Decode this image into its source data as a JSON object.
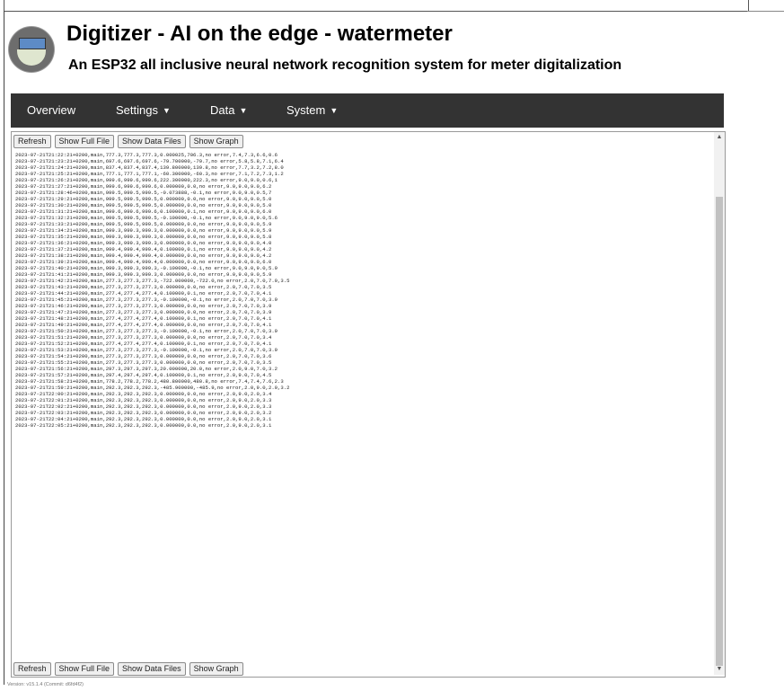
{
  "header": {
    "title": "Digitizer - AI on the edge - watermeter",
    "subtitle": "An ESP32 all inclusive neural network recognition system for meter digitalization"
  },
  "nav": [
    {
      "label": "Overview",
      "dropdown": false
    },
    {
      "label": "Settings",
      "dropdown": true
    },
    {
      "label": "Data",
      "dropdown": true
    },
    {
      "label": "System",
      "dropdown": true
    }
  ],
  "buttons": {
    "refresh": "Refresh",
    "show_full_file": "Show Full File",
    "show_data_files": "Show Data Files",
    "show_graph": "Show Graph"
  },
  "log_lines": [
    "2023-07-21T21:22:21+0200,main,777.3,777.3,777.3,0.000025,706.3,no error,7.4,7.3,6.6,0.6",
    "2023-07-21T21:23:21+0200,main,697.6,697.6,697.6,-79.700000,-79.7,no error,5.8,5.8,7.1,6.4",
    "2023-07-21T21:24:21+0200,main,837.4,837.4,837.4,139.800000,139.8,no error,7.7,3.2,7.2,8.0",
    "2023-07-21T21:25:21+0200,main,777.1,777.1,777.1,-60.300000,-60.3,no error,7.1,7.2,7.3,1.2",
    "2023-07-21T21:26:21+0200,main,999.6,999.6,999.6,222.300000,222.3,no error,9.0,9.0,0.6,1",
    "2023-07-21T21:27:21+0200,main,999.6,999.6,999.6,0.000000,0.0,no error,9.0,9.0,9.0,6.2",
    "2023-07-21T21:28:46+0200,main,999.5,999.5,999.5,-0.073888,-0.1,no error,9.0,9.0,0.5,7",
    "2023-07-21T21:29:21+0200,main,999.5,999.5,999.5,0.000000,0.0,no error,9.0,9.0,9.0,5.0",
    "2023-07-21T21:30:21+0200,main,999.5,999.5,999.5,0.000000,0.0,no error,9.0,9.0,9.0,5.0",
    "2023-07-21T21:31:21+0200,main,999.6,999.6,999.6,0.100000,0.1,no error,9.0,9.0,9.0,6.0",
    "2023-07-21T21:32:21+0200,main,999.5,999.5,999.5,-0.100000,-0.1,no error,9.0,9.0,9.0,5.6",
    "2023-07-21T21:33:21+0200,main,999.5,999.5,999.5,0.000000,0.0,no error,9.0,9.0,9.0,5.9",
    "2023-07-21T21:34:21+0200,main,999.3,999.3,999.3,0.000000,0.0,no error,9.0,9.0,9.0,5.9",
    "2023-07-21T21:35:21+0200,main,999.3,999.3,999.3,0.000000,0.0,no error,9.0,9.0,9.0,5.8",
    "2023-07-21T21:36:21+0200,main,999.3,999.3,999.3,0.000000,0.0,no error,9.0,9.0,9.0,4.0",
    "2023-07-21T21:37:21+0200,main,999.4,999.4,999.4,0.100000,0.1,no error,9.0,9.0,9.0,4.2",
    "2023-07-21T21:38:21+0200,main,999.4,999.4,999.4,0.000000,0.0,no error,9.0,9.0,9.0,4.2",
    "2023-07-21T21:39:21+0200,main,999.4,999.4,999.4,0.000000,0.0,no error,9.0,9.0,9.0,6.0",
    "2023-07-21T21:40:21+0200,main,999.3,999.3,999.3,-0.100000,-0.1,no error,9.0,9.0,9.0,5.9",
    "2023-07-21T21:41:21+0200,main,999.3,999.3,999.3,0.000000,0.0,no error,9.0,9.0,9.0,5.9",
    "2023-07-21T21:42:21+0200,main,277.3,277.3,277.3,-722.000000,-722.0,no error,2.0,7.0,7.0,3.5",
    "2023-07-21T21:43:21+0200,main,277.3,277.3,277.3,0.000000,0.0,no error,2.0,7.0,7.0,3.5",
    "2023-07-21T21:44:21+0200,main,277.4,277.4,277.4,0.100000,0.1,no error,2.0,7.0,7.0,4.1",
    "2023-07-21T21:45:21+0200,main,277.3,277.3,277.3,-0.100000,-0.1,no error,2.0,7.0,7.0,3.9",
    "2023-07-21T21:46:21+0200,main,277.3,277.3,277.3,0.000000,0.0,no error,2.0,7.0,7.0,3.9",
    "2023-07-21T21:47:21+0200,main,277.3,277.3,277.3,0.000000,0.0,no error,2.0,7.0,7.0,3.9",
    "2023-07-21T21:48:21+0200,main,277.4,277.4,277.4,0.100000,0.1,no error,2.0,7.0,7.0,4.1",
    "2023-07-21T21:49:21+0200,main,277.4,277.4,277.4,0.000000,0.0,no error,2.0,7.0,7.0,4.1",
    "2023-07-21T21:50:21+0200,main,277.3,277.3,277.3,-0.100000,-0.1,no error,2.0,7.0,7.0,3.9",
    "2023-07-21T21:51:21+0200,main,277.3,277.3,277.3,0.000000,0.0,no error,2.0,7.0,7.0,3.4",
    "2023-07-21T21:52:21+0200,main,277.4,277.4,277.4,0.100000,0.1,no error,2.0,7.0,7.0,4.1",
    "2023-07-21T21:53:21+0200,main,277.3,277.3,277.3,-0.100000,-0.1,no error,2.0,7.0,7.0,3.9",
    "2023-07-21T21:54:21+0200,main,277.3,277.3,277.3,0.000000,0.0,no error,2.0,7.0,7.0,3.6",
    "2023-07-21T21:55:21+0200,main,277.3,277.3,277.3,0.000000,0.0,no error,2.0,7.0,7.0,3.5",
    "2023-07-21T21:56:21+0200,main,297.3,297.3,297.3,20.000000,20.0,no error,2.0,9.0,7.0,3.2",
    "2023-07-21T21:57:21+0200,main,297.4,297.4,297.4,0.100000,0.1,no error,2.0,9.0,7.0,4.5",
    "2023-07-21T21:58:21+0200,main,778.2,778.2,778.2,480.800000,480.8,no error,7.4,7.4,7.6,2.3",
    "2023-07-21T21:59:21+0200,main,292.3,292.3,292.3,-485.900000,-485.9,no error,2.0,9.0,2.0,3.2",
    "2023-07-21T22:00:21+0200,main,292.3,292.3,292.3,0.000000,0.0,no error,2.0,9.0,2.0,3.4",
    "2023-07-21T22:01:21+0200,main,292.3,292.3,292.3,0.000000,0.0,no error,2.0,9.0,2.0,3.3",
    "2023-07-21T22:02:21+0200,main,292.3,292.3,292.3,0.000000,0.0,no error,2.0,9.0,2.0,3.3",
    "2023-07-21T22:03:21+0200,main,292.3,292.3,292.3,0.000000,0.0,no error,2.0,9.0,2.0,3.2",
    "2023-07-21T22:04:21+0200,main,292.3,292.3,292.3,0.000000,0.0,no error,2.0,9.0,2.0,3.1",
    "2023-07-21T22:05:21+0200,main,292.3,292.3,292.3,0.000000,0.0,no error,2.0,9.0,2.0,3.1"
  ],
  "footer": {
    "text": "Version: v15.1.4 (Commit: d6fd4f2)"
  },
  "colors": {
    "navbar_bg": "#333333",
    "navbar_text": "#ffffff",
    "button_bg": "#efefef"
  }
}
